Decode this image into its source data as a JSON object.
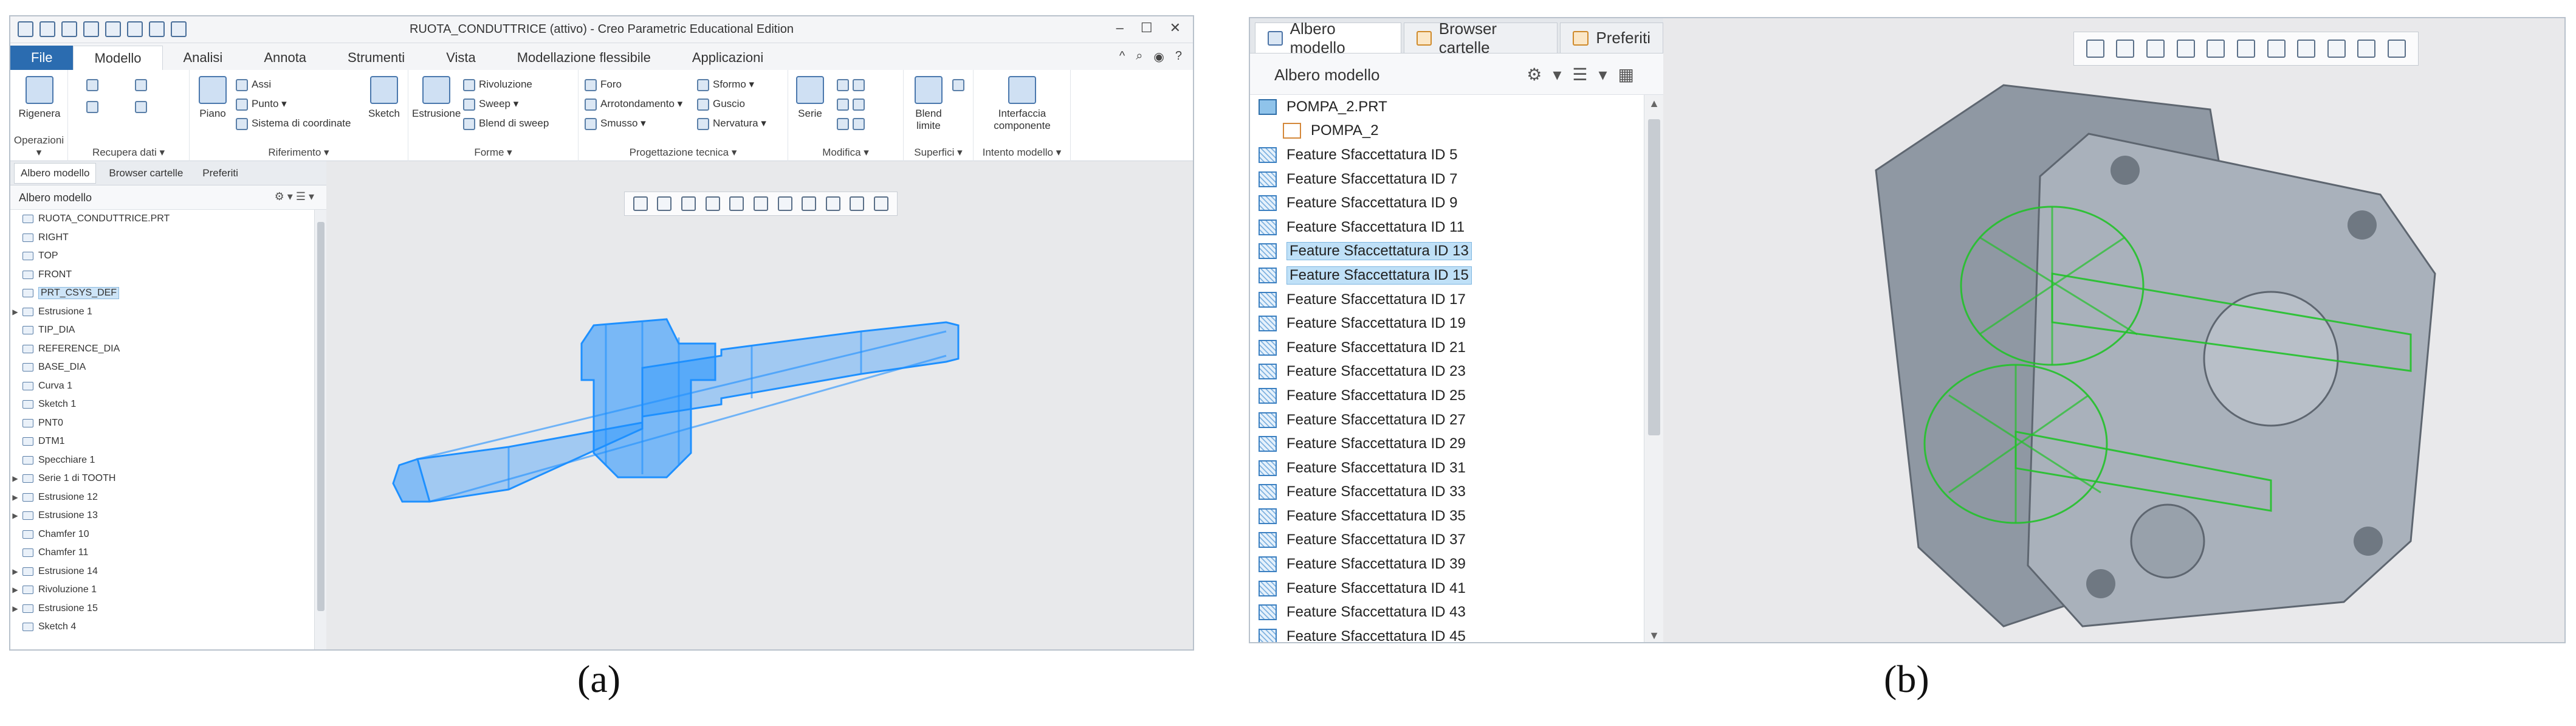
{
  "panel_a": {
    "caption": "(a)",
    "title": "RUOTA_CONDUTTRICE (attivo) - Creo Parametric Educational Edition",
    "window_controls": [
      "–",
      "☐",
      "✕"
    ],
    "tabs": [
      "File",
      "Modello",
      "Analisi",
      "Annota",
      "Strumenti",
      "Vista",
      "Modellazione flessibile",
      "Applicazioni"
    ],
    "active_tab": "Modello",
    "tabs_right_icons": [
      "^",
      "⌕",
      "◉",
      "?"
    ],
    "ribbon_groups": [
      {
        "label": "Operazioni ▾",
        "buttons": [
          "Rigenera"
        ]
      },
      {
        "label": "Recupera dati ▾",
        "buttons": []
      },
      {
        "label": "Riferimento ▾",
        "buttons": [
          "Piano",
          "Assi",
          "Punto ▾",
          "Sistema di coordinate",
          "Sketch"
        ]
      },
      {
        "label": "Forme ▾",
        "buttons": [
          "Estrusione",
          "Rivoluzione",
          "Sweep ▾",
          "Blend di sweep"
        ]
      },
      {
        "label": "Progettazione tecnica ▾",
        "buttons": [
          "Foro",
          "Arrotondamento ▾",
          "Smusso ▾",
          "Sformo ▾",
          "Guscio",
          "Nervatura ▾"
        ]
      },
      {
        "label": "Modifica ▾",
        "buttons": [
          "Serie"
        ]
      },
      {
        "label": "Superfici ▾",
        "buttons": [
          "Blend limite"
        ]
      },
      {
        "label": "Intento modello ▾",
        "buttons": [
          "Interfaccia componente"
        ]
      }
    ],
    "nav_tabs": [
      "Albero modello",
      "Browser cartelle",
      "Preferiti"
    ],
    "tree_header": "Albero modello",
    "tree_items": [
      {
        "label": "RUOTA_CONDUTTRICE.PRT",
        "expand": "",
        "selected": false
      },
      {
        "label": "RIGHT",
        "expand": "",
        "selected": false
      },
      {
        "label": "TOP",
        "expand": "",
        "selected": false
      },
      {
        "label": "FRONT",
        "expand": "",
        "selected": false
      },
      {
        "label": "PRT_CSYS_DEF",
        "expand": "",
        "selected": true
      },
      {
        "label": "Estrusione 1",
        "expand": "▶",
        "selected": false
      },
      {
        "label": "TIP_DIA",
        "expand": "",
        "selected": false
      },
      {
        "label": "REFERENCE_DIA",
        "expand": "",
        "selected": false
      },
      {
        "label": "BASE_DIA",
        "expand": "",
        "selected": false
      },
      {
        "label": "Curva 1",
        "expand": "",
        "selected": false
      },
      {
        "label": "Sketch 1",
        "expand": "",
        "selected": false
      },
      {
        "label": "PNT0",
        "expand": "",
        "selected": false
      },
      {
        "label": "DTM1",
        "expand": "",
        "selected": false
      },
      {
        "label": "Specchiare 1",
        "expand": "",
        "selected": false
      },
      {
        "label": "Serie 1 di TOOTH",
        "expand": "▶",
        "selected": false
      },
      {
        "label": "Estrusione 12",
        "expand": "▶",
        "selected": false
      },
      {
        "label": "Estrusione 13",
        "expand": "▶",
        "selected": false
      },
      {
        "label": "Chamfer 10",
        "expand": "",
        "selected": false
      },
      {
        "label": "Chamfer 11",
        "expand": "",
        "selected": false
      },
      {
        "label": "Estrusione 14",
        "expand": "▶",
        "selected": false
      },
      {
        "label": "Rivoluzione 1",
        "expand": "▶",
        "selected": false
      },
      {
        "label": "Estrusione 15",
        "expand": "▶",
        "selected": false
      },
      {
        "label": "Sketch 4",
        "expand": "",
        "selected": false
      }
    ],
    "model_color": "#1e90ff"
  },
  "panel_b": {
    "caption": "(b)",
    "nav_tabs": [
      "Albero modello",
      "Browser cartelle",
      "Preferiti"
    ],
    "active_nav_tab": "Albero modello",
    "tree_header": "Albero modello",
    "tree_items": [
      {
        "label": "POMPA_2.PRT",
        "kind": "part",
        "selected": false
      },
      {
        "label": "POMPA_2",
        "kind": "csys",
        "selected": false
      },
      {
        "label": "Feature Sfaccettatura ID 5",
        "kind": "facet",
        "selected": false
      },
      {
        "label": "Feature Sfaccettatura ID 7",
        "kind": "facet",
        "selected": false
      },
      {
        "label": "Feature Sfaccettatura ID 9",
        "kind": "facet",
        "selected": false
      },
      {
        "label": "Feature Sfaccettatura ID 11",
        "kind": "facet",
        "selected": false
      },
      {
        "label": "Feature Sfaccettatura ID 13",
        "kind": "facet",
        "selected": true
      },
      {
        "label": "Feature Sfaccettatura ID 15",
        "kind": "facet",
        "selected": true
      },
      {
        "label": "Feature Sfaccettatura ID 17",
        "kind": "facet",
        "selected": false
      },
      {
        "label": "Feature Sfaccettatura ID 19",
        "kind": "facet",
        "selected": false
      },
      {
        "label": "Feature Sfaccettatura ID 21",
        "kind": "facet",
        "selected": false
      },
      {
        "label": "Feature Sfaccettatura ID 23",
        "kind": "facet",
        "selected": false
      },
      {
        "label": "Feature Sfaccettatura ID 25",
        "kind": "facet",
        "selected": false
      },
      {
        "label": "Feature Sfaccettatura ID 27",
        "kind": "facet",
        "selected": false
      },
      {
        "label": "Feature Sfaccettatura ID 29",
        "kind": "facet",
        "selected": false
      },
      {
        "label": "Feature Sfaccettatura ID 31",
        "kind": "facet",
        "selected": false
      },
      {
        "label": "Feature Sfaccettatura ID 33",
        "kind": "facet",
        "selected": false
      },
      {
        "label": "Feature Sfaccettatura ID 35",
        "kind": "facet",
        "selected": false
      },
      {
        "label": "Feature Sfaccettatura ID 37",
        "kind": "facet",
        "selected": false
      },
      {
        "label": "Feature Sfaccettatura ID 39",
        "kind": "facet",
        "selected": false
      },
      {
        "label": "Feature Sfaccettatura ID 41",
        "kind": "facet",
        "selected": false
      },
      {
        "label": "Feature Sfaccettatura ID 43",
        "kind": "facet",
        "selected": false
      },
      {
        "label": "Feature Sfaccettatura ID 45",
        "kind": "facet",
        "selected": false
      }
    ],
    "body_color": "#9aa3ad",
    "wireframe_color": "#22c22a"
  }
}
